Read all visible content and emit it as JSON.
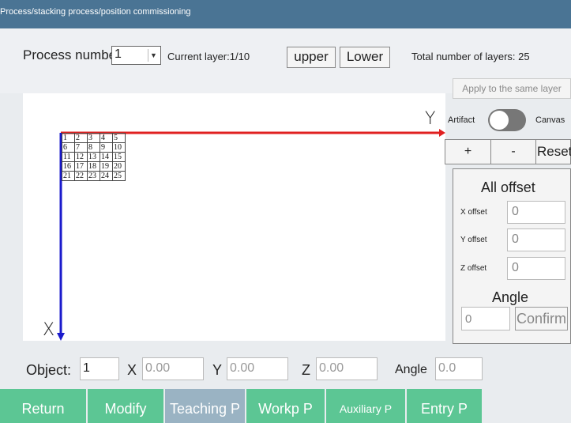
{
  "window": {
    "title": "Process/stacking process/position commissioning"
  },
  "header": {
    "process_label": "Process number",
    "process_value": "1",
    "current_layer": "Current layer:1/10",
    "upper_label": "upper",
    "lower_label": "Lower",
    "total_layers": "Total number of layers: 25"
  },
  "apply_label": "Apply to the same layer",
  "toggle": {
    "left_label": "Artifact",
    "right_label": "Canvas",
    "on": false
  },
  "view_buttons": {
    "plus": "+",
    "minus": "-",
    "reset": "Reset"
  },
  "canvas": {
    "y_axis_label": "Y",
    "x_axis_label": "X",
    "grid": [
      [
        "1",
        "2",
        "3",
        "4",
        "5"
      ],
      [
        "6",
        "7",
        "8",
        "9",
        "10"
      ],
      [
        "11",
        "12",
        "13",
        "14",
        "15"
      ],
      [
        "16",
        "17",
        "18",
        "19",
        "20"
      ],
      [
        "21",
        "22",
        "23",
        "24",
        "25"
      ]
    ],
    "colors": {
      "y_axis": "#e02020",
      "x_axis": "#1a1acc"
    }
  },
  "offsets": {
    "title": "All offset",
    "x_label": "X offset",
    "x_value": "0",
    "y_label": "Y offset",
    "y_value": "0",
    "z_label": "Z offset",
    "z_value": "0",
    "angle_title": "Angle",
    "angle_value": "0",
    "confirm_label": "Confirm"
  },
  "object_row": {
    "object_label": "Object:",
    "object_value": "1",
    "x_label": "X",
    "x_value": "0.00",
    "y_label": "Y",
    "y_value": "0.00",
    "z_label": "Z",
    "z_value": "0.00",
    "angle_label": "Angle",
    "angle_value": "0.0"
  },
  "tabs": [
    {
      "label": "Return",
      "active": false
    },
    {
      "label": "Modify",
      "active": false
    },
    {
      "label": "Teaching P",
      "active": true
    },
    {
      "label": "Workp P",
      "active": false
    },
    {
      "label": "Auxiliary P",
      "active": false
    },
    {
      "label": "Entry P",
      "active": false
    }
  ],
  "colors": {
    "titlebar": "#4a7494",
    "tab": "#5cc694",
    "tab_active": "#9ab3c3"
  }
}
